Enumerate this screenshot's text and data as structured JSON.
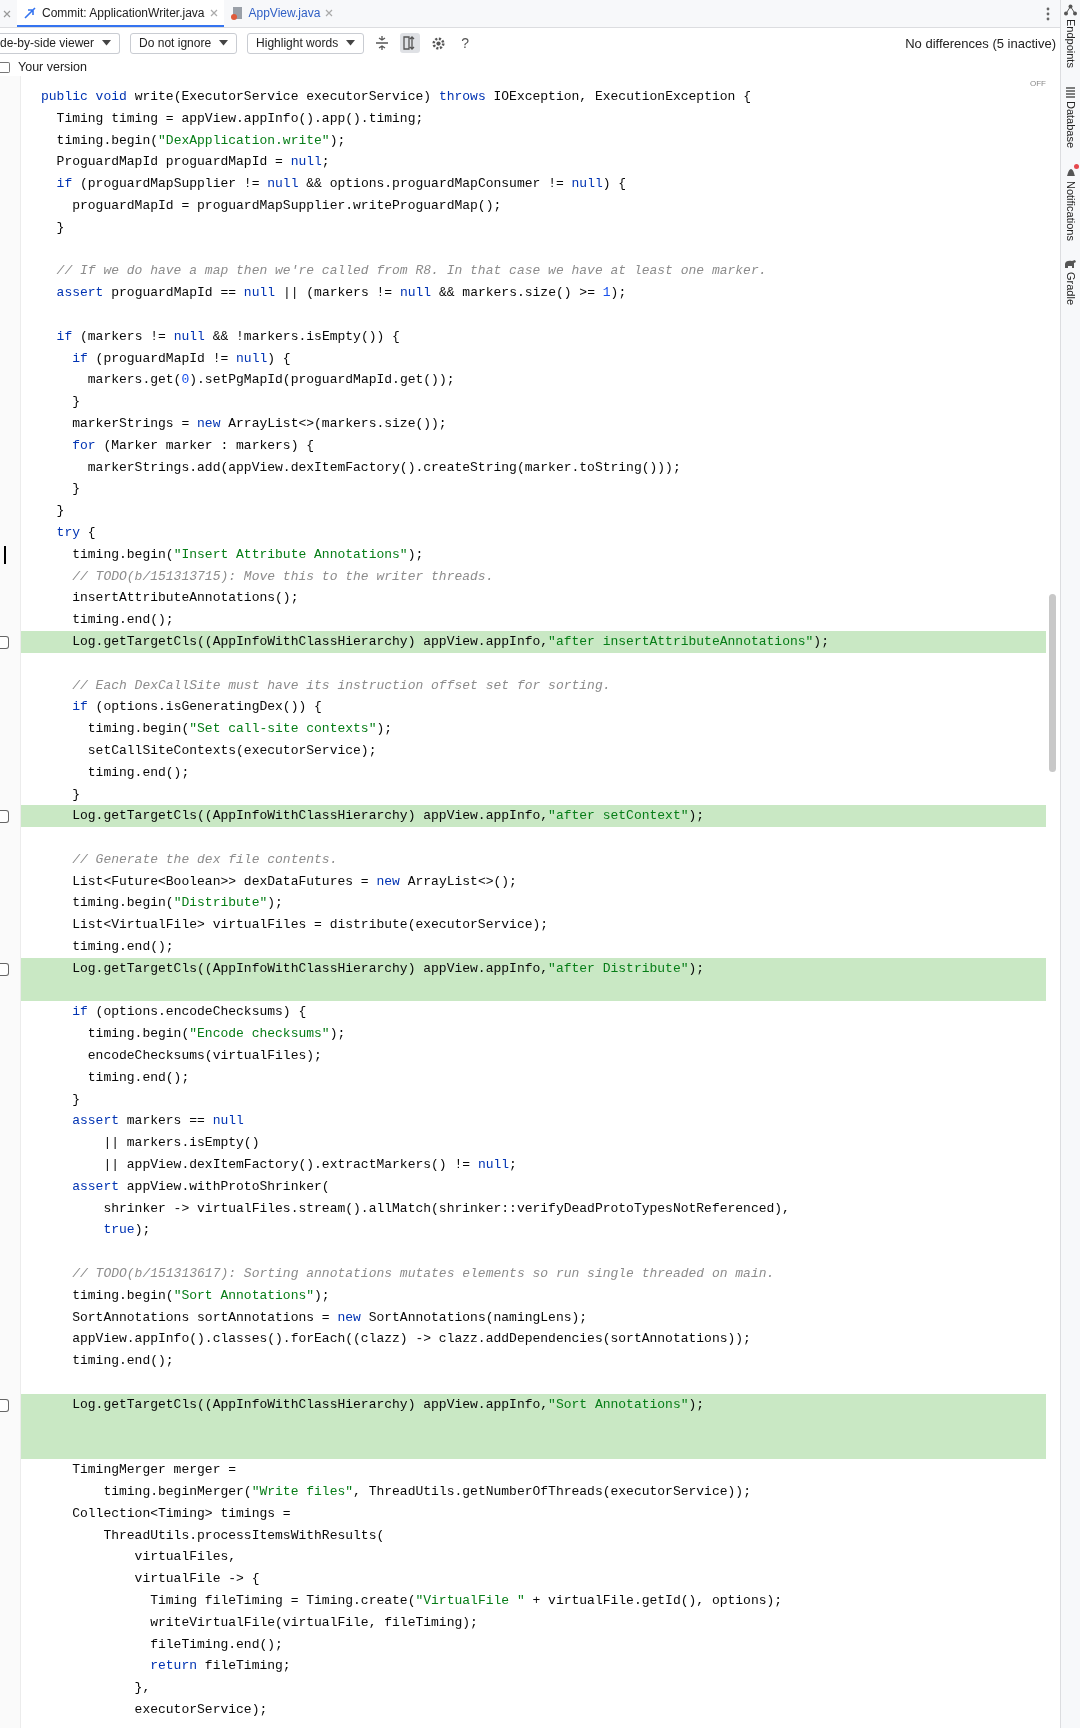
{
  "tabs": [
    {
      "label": "Commit: ApplicationWriter.java",
      "selected": true,
      "kind": "commit"
    },
    {
      "label": "AppView.java",
      "selected": false,
      "kind": "java"
    }
  ],
  "toolbar": {
    "dropdowns": [
      "de-by-side viewer",
      "Do not ignore",
      "Highlight words"
    ],
    "sync_scroll_on": true,
    "help": "?",
    "status": "No differences (5 inactive)"
  },
  "version": {
    "label": "Your version",
    "checked": false
  },
  "editor": {
    "badge": "OFF",
    "lines": [
      {
        "changed": false,
        "tokens": [
          {
            "kind": "keyword",
            "text": "public void"
          },
          {
            "kind": "code",
            "text": " write(ExecutorService executorService) "
          },
          {
            "kind": "keyword",
            "text": "throws"
          },
          {
            "kind": "code",
            "text": " IOException, ExecutionException {"
          }
        ]
      },
      {
        "changed": false,
        "tokens": [
          {
            "kind": "code",
            "text": "  Timing timing = appView.appInfo().app().timing;"
          }
        ]
      },
      {
        "changed": false,
        "tokens": [
          {
            "kind": "code",
            "text": "  timing.begin("
          },
          {
            "kind": "string",
            "text": "\"DexApplication.write\""
          },
          {
            "kind": "code",
            "text": ");"
          }
        ]
      },
      {
        "changed": false,
        "tokens": [
          {
            "kind": "code",
            "text": "  ProguardMapId proguardMapId = "
          },
          {
            "kind": "keyword",
            "text": "null"
          },
          {
            "kind": "code",
            "text": ";"
          }
        ]
      },
      {
        "changed": false,
        "tokens": [
          {
            "kind": "keyword",
            "text": "  if"
          },
          {
            "kind": "code",
            "text": " (proguardMapSupplier != "
          },
          {
            "kind": "keyword",
            "text": "null"
          },
          {
            "kind": "code",
            "text": " && options.proguardMapConsumer != "
          },
          {
            "kind": "keyword",
            "text": "null"
          },
          {
            "kind": "code",
            "text": ") {"
          }
        ]
      },
      {
        "changed": false,
        "tokens": [
          {
            "kind": "code",
            "text": "    proguardMapId = proguardMapSupplier.writeProguardMap();"
          }
        ]
      },
      {
        "changed": false,
        "tokens": [
          {
            "kind": "code",
            "text": "  }"
          }
        ]
      },
      {
        "changed": false
      },
      {
        "changed": false,
        "tokens": [
          {
            "kind": "comment",
            "text": "  // If we do have a map then we're called from R8. In that case we have at least one marker."
          }
        ]
      },
      {
        "changed": false,
        "tokens": [
          {
            "kind": "keyword",
            "text": "  assert"
          },
          {
            "kind": "code",
            "text": " proguardMapId == "
          },
          {
            "kind": "keyword",
            "text": "null"
          },
          {
            "kind": "code",
            "text": " || (markers != "
          },
          {
            "kind": "keyword",
            "text": "null"
          },
          {
            "kind": "code",
            "text": " && markers.size() >= "
          },
          {
            "kind": "number",
            "text": "1"
          },
          {
            "kind": "code",
            "text": ");"
          }
        ]
      },
      {
        "changed": false
      },
      {
        "changed": false,
        "tokens": [
          {
            "kind": "keyword",
            "text": "  if"
          },
          {
            "kind": "code",
            "text": " (markers != "
          },
          {
            "kind": "keyword",
            "text": "null"
          },
          {
            "kind": "code",
            "text": " && !markers.isEmpty()) {"
          }
        ]
      },
      {
        "changed": false,
        "tokens": [
          {
            "kind": "keyword",
            "text": "    if"
          },
          {
            "kind": "code",
            "text": " (proguardMapId != "
          },
          {
            "kind": "keyword",
            "text": "null"
          },
          {
            "kind": "code",
            "text": ") {"
          }
        ]
      },
      {
        "changed": false,
        "tokens": [
          {
            "kind": "code",
            "text": "      markers.get("
          },
          {
            "kind": "number",
            "text": "0"
          },
          {
            "kind": "code",
            "text": ").setPgMapId(proguardMapId.get());"
          }
        ]
      },
      {
        "changed": false,
        "tokens": [
          {
            "kind": "code",
            "text": "    }"
          }
        ]
      },
      {
        "changed": false,
        "tokens": [
          {
            "kind": "code",
            "text": "    markerStrings = "
          },
          {
            "kind": "keyword",
            "text": "new"
          },
          {
            "kind": "code",
            "text": " ArrayList<>(markers.size());"
          }
        ]
      },
      {
        "changed": false,
        "tokens": [
          {
            "kind": "keyword",
            "text": "    for"
          },
          {
            "kind": "code",
            "text": " (Marker marker : markers) {"
          }
        ]
      },
      {
        "changed": false,
        "tokens": [
          {
            "kind": "code",
            "text": "      markerStrings.add(appView.dexItemFactory().createString(marker.toString()));"
          }
        ]
      },
      {
        "changed": false,
        "tokens": [
          {
            "kind": "code",
            "text": "    }"
          }
        ]
      },
      {
        "changed": false,
        "tokens": [
          {
            "kind": "code",
            "text": "  }"
          }
        ]
      },
      {
        "changed": false,
        "tokens": [
          {
            "kind": "keyword",
            "text": "  try"
          },
          {
            "kind": "code",
            "text": " {"
          }
        ]
      },
      {
        "changed": false,
        "caret": true,
        "tokens": [
          {
            "kind": "code",
            "text": "    timing.begin("
          },
          {
            "kind": "string",
            "text": "\"Insert Attribute Annotations\""
          },
          {
            "kind": "code",
            "text": ");"
          }
        ]
      },
      {
        "changed": false,
        "tokens": [
          {
            "kind": "comment",
            "text": "    // TODO(b/151313715): Move this to the writer threads."
          }
        ]
      },
      {
        "changed": false,
        "tokens": [
          {
            "kind": "code",
            "text": "    insertAttributeAnnotations();"
          }
        ]
      },
      {
        "changed": false,
        "tokens": [
          {
            "kind": "code",
            "text": "    timing.end();"
          }
        ]
      },
      {
        "changed": true,
        "checked": false,
        "tokens": [
          {
            "kind": "code",
            "text": "    Log.getTargetCls((AppInfoWithClassHierarchy) appView.appInfo,"
          },
          {
            "kind": "string",
            "text": "\"after insertAttributeAnnotations\""
          },
          {
            "kind": "code",
            "text": ");"
          }
        ]
      },
      {
        "changed": false
      },
      {
        "changed": false,
        "tokens": [
          {
            "kind": "comment",
            "text": "    // Each DexCallSite must have its instruction offset set for sorting."
          }
        ]
      },
      {
        "changed": false,
        "tokens": [
          {
            "kind": "keyword",
            "text": "    if"
          },
          {
            "kind": "code",
            "text": " (options.isGeneratingDex()) {"
          }
        ]
      },
      {
        "changed": false,
        "tokens": [
          {
            "kind": "code",
            "text": "      timing.begin("
          },
          {
            "kind": "string",
            "text": "\"Set call-site contexts\""
          },
          {
            "kind": "code",
            "text": ");"
          }
        ]
      },
      {
        "changed": false,
        "tokens": [
          {
            "kind": "code",
            "text": "      setCallSiteContexts(executorService);"
          }
        ]
      },
      {
        "changed": false,
        "tokens": [
          {
            "kind": "code",
            "text": "      timing.end();"
          }
        ]
      },
      {
        "changed": false,
        "tokens": [
          {
            "kind": "code",
            "text": "    }"
          }
        ]
      },
      {
        "changed": true,
        "checked": false,
        "tokens": [
          {
            "kind": "code",
            "text": "    Log.getTargetCls((AppInfoWithClassHierarchy) appView.appInfo,"
          },
          {
            "kind": "string",
            "text": "\"after setContext\""
          },
          {
            "kind": "code",
            "text": ");"
          }
        ]
      },
      {
        "changed": false
      },
      {
        "changed": false,
        "tokens": [
          {
            "kind": "comment",
            "text": "    // Generate the dex file contents."
          }
        ]
      },
      {
        "changed": false,
        "tokens": [
          {
            "kind": "code",
            "text": "    List<Future<Boolean>> dexDataFutures = "
          },
          {
            "kind": "keyword",
            "text": "new"
          },
          {
            "kind": "code",
            "text": " ArrayList<>();"
          }
        ]
      },
      {
        "changed": false,
        "tokens": [
          {
            "kind": "code",
            "text": "    timing.begin("
          },
          {
            "kind": "string",
            "text": "\"Distribute\""
          },
          {
            "kind": "code",
            "text": ");"
          }
        ]
      },
      {
        "changed": false,
        "tokens": [
          {
            "kind": "code",
            "text": "    List<VirtualFile> virtualFiles = distribute(executorService);"
          }
        ]
      },
      {
        "changed": false,
        "tokens": [
          {
            "kind": "code",
            "text": "    timing.end();"
          }
        ]
      },
      {
        "changed": true,
        "checked": false,
        "tokens": [
          {
            "kind": "code",
            "text": "    Log.getTargetCls((AppInfoWithClassHierarchy) appView.appInfo,"
          },
          {
            "kind": "string",
            "text": "\"after Distribute\""
          },
          {
            "kind": "code",
            "text": ");"
          }
        ]
      },
      {
        "changed": true
      },
      {
        "changed": false,
        "tokens": [
          {
            "kind": "keyword",
            "text": "    if"
          },
          {
            "kind": "code",
            "text": " (options.encodeChecksums) {"
          }
        ]
      },
      {
        "changed": false,
        "tokens": [
          {
            "kind": "code",
            "text": "      timing.begin("
          },
          {
            "kind": "string",
            "text": "\"Encode checksums\""
          },
          {
            "kind": "code",
            "text": ");"
          }
        ]
      },
      {
        "changed": false,
        "tokens": [
          {
            "kind": "code",
            "text": "      encodeChecksums(virtualFiles);"
          }
        ]
      },
      {
        "changed": false,
        "tokens": [
          {
            "kind": "code",
            "text": "      timing.end();"
          }
        ]
      },
      {
        "changed": false,
        "tokens": [
          {
            "kind": "code",
            "text": "    }"
          }
        ]
      },
      {
        "changed": false,
        "tokens": [
          {
            "kind": "keyword",
            "text": "    assert"
          },
          {
            "kind": "code",
            "text": " markers == "
          },
          {
            "kind": "keyword",
            "text": "null"
          }
        ]
      },
      {
        "changed": false,
        "tokens": [
          {
            "kind": "code",
            "text": "        || markers.isEmpty()"
          }
        ]
      },
      {
        "changed": false,
        "tokens": [
          {
            "kind": "code",
            "text": "        || appView.dexItemFactory().extractMarkers() != "
          },
          {
            "kind": "keyword",
            "text": "null"
          },
          {
            "kind": "code",
            "text": ";"
          }
        ]
      },
      {
        "changed": false,
        "tokens": [
          {
            "kind": "keyword",
            "text": "    assert"
          },
          {
            "kind": "code",
            "text": " appView.withProtoShrinker("
          }
        ]
      },
      {
        "changed": false,
        "tokens": [
          {
            "kind": "code",
            "text": "        shrinker -> virtualFiles.stream().allMatch(shrinker::verifyDeadProtoTypesNotReferenced),"
          }
        ]
      },
      {
        "changed": false,
        "tokens": [
          {
            "kind": "keyword",
            "text": "        true"
          },
          {
            "kind": "code",
            "text": ");"
          }
        ]
      },
      {
        "changed": false
      },
      {
        "changed": false,
        "tokens": [
          {
            "kind": "comment",
            "text": "    // TODO(b/151313617): Sorting annotations mutates elements so run single threaded on main."
          }
        ]
      },
      {
        "changed": false,
        "tokens": [
          {
            "kind": "code",
            "text": "    timing.begin("
          },
          {
            "kind": "string",
            "text": "\"Sort Annotations\""
          },
          {
            "kind": "code",
            "text": ");"
          }
        ]
      },
      {
        "changed": false,
        "tokens": [
          {
            "kind": "code",
            "text": "    SortAnnotations sortAnnotations = "
          },
          {
            "kind": "keyword",
            "text": "new"
          },
          {
            "kind": "code",
            "text": " SortAnnotations(namingLens);"
          }
        ]
      },
      {
        "changed": false,
        "tokens": [
          {
            "kind": "code",
            "text": "    appView.appInfo().classes().forEach((clazz) -> clazz.addDependencies(sortAnnotations));"
          }
        ]
      },
      {
        "changed": false,
        "tokens": [
          {
            "kind": "code",
            "text": "    timing.end();"
          }
        ]
      },
      {
        "changed": false
      },
      {
        "changed": true,
        "checked": false,
        "tokens": [
          {
            "kind": "code",
            "text": "    Log.getTargetCls((AppInfoWithClassHierarchy) appView.appInfo,"
          },
          {
            "kind": "string",
            "text": "\"Sort Annotations\""
          },
          {
            "kind": "code",
            "text": ");"
          }
        ]
      },
      {
        "changed": true
      },
      {
        "changed": true
      },
      {
        "changed": false,
        "tokens": [
          {
            "kind": "code",
            "text": "    TimingMerger merger ="
          }
        ]
      },
      {
        "changed": false,
        "tokens": [
          {
            "kind": "code",
            "text": "        timing.beginMerger("
          },
          {
            "kind": "string",
            "text": "\"Write files\""
          },
          {
            "kind": "code",
            "text": ", ThreadUtils.getNumberOfThreads(executorService));"
          }
        ]
      },
      {
        "changed": false,
        "tokens": [
          {
            "kind": "code",
            "text": "    Collection<Timing> timings ="
          }
        ]
      },
      {
        "changed": false,
        "tokens": [
          {
            "kind": "code",
            "text": "        ThreadUtils.processItemsWithResults("
          }
        ]
      },
      {
        "changed": false,
        "tokens": [
          {
            "kind": "code",
            "text": "            virtualFiles,"
          }
        ]
      },
      {
        "changed": false,
        "tokens": [
          {
            "kind": "code",
            "text": "            virtualFile -> {"
          }
        ]
      },
      {
        "changed": false,
        "tokens": [
          {
            "kind": "code",
            "text": "              Timing fileTiming = Timing.create("
          },
          {
            "kind": "string",
            "text": "\"VirtualFile \""
          },
          {
            "kind": "code",
            "text": " + virtualFile.getId(), options);"
          }
        ]
      },
      {
        "changed": false,
        "tokens": [
          {
            "kind": "code",
            "text": "              writeVirtualFile(virtualFile, fileTiming);"
          }
        ]
      },
      {
        "changed": false,
        "tokens": [
          {
            "kind": "code",
            "text": "              fileTiming.end();"
          }
        ]
      },
      {
        "changed": false,
        "tokens": [
          {
            "kind": "keyword",
            "text": "              return"
          },
          {
            "kind": "code",
            "text": " fileTiming;"
          }
        ]
      },
      {
        "changed": false,
        "tokens": [
          {
            "kind": "code",
            "text": "            },"
          }
        ]
      },
      {
        "changed": false,
        "tokens": [
          {
            "kind": "code",
            "text": "            executorService);"
          }
        ]
      }
    ]
  },
  "tool_windows": [
    {
      "label": "Endpoints",
      "kind": "endpoints",
      "badge": false
    },
    {
      "label": "Database",
      "kind": "database",
      "badge": false
    },
    {
      "label": "Notifications",
      "kind": "notifications",
      "badge": true
    },
    {
      "label": "Gradle",
      "kind": "gradle",
      "badge": false
    }
  ]
}
